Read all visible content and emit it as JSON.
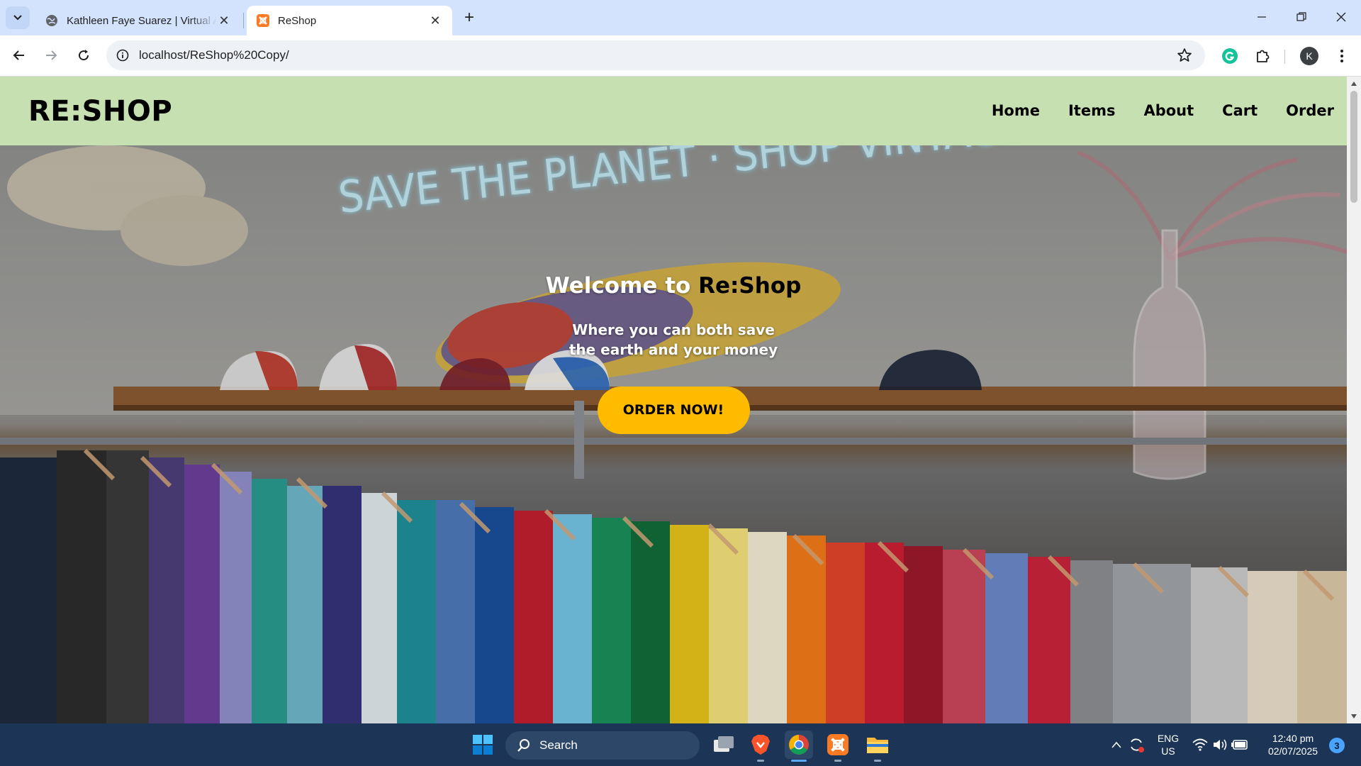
{
  "browser": {
    "tabs": [
      {
        "title": "Kathleen Faye Suarez | Virtual Assistant",
        "favicon": "globe-icon",
        "active": false
      },
      {
        "title": "ReShop",
        "favicon": "xampp-icon",
        "active": true
      }
    ],
    "url": "localhost/ReShop%20Copy/",
    "profile_initial": "K"
  },
  "site": {
    "logo": "RE:SHOP",
    "nav": [
      "Home",
      "Items",
      "About",
      "Cart",
      "Order"
    ],
    "hero": {
      "title_prefix": "Welcome to ",
      "title_brand": "Re:Shop",
      "subtitle_line1": "Where you can both save",
      "subtitle_line2": "the earth and your money",
      "cta": "ORDER NOW!",
      "neon_sign": "SAVE THE PLANET · SHOP VINTAGE"
    },
    "colors": {
      "header_bg": "#c7e0b2",
      "cta_bg": "#ffbb00"
    }
  },
  "taskbar": {
    "search_placeholder": "Search",
    "language": "ENG",
    "region": "US",
    "time": "12:40 pm",
    "date": "02/07/2025",
    "notification_count": "3"
  }
}
